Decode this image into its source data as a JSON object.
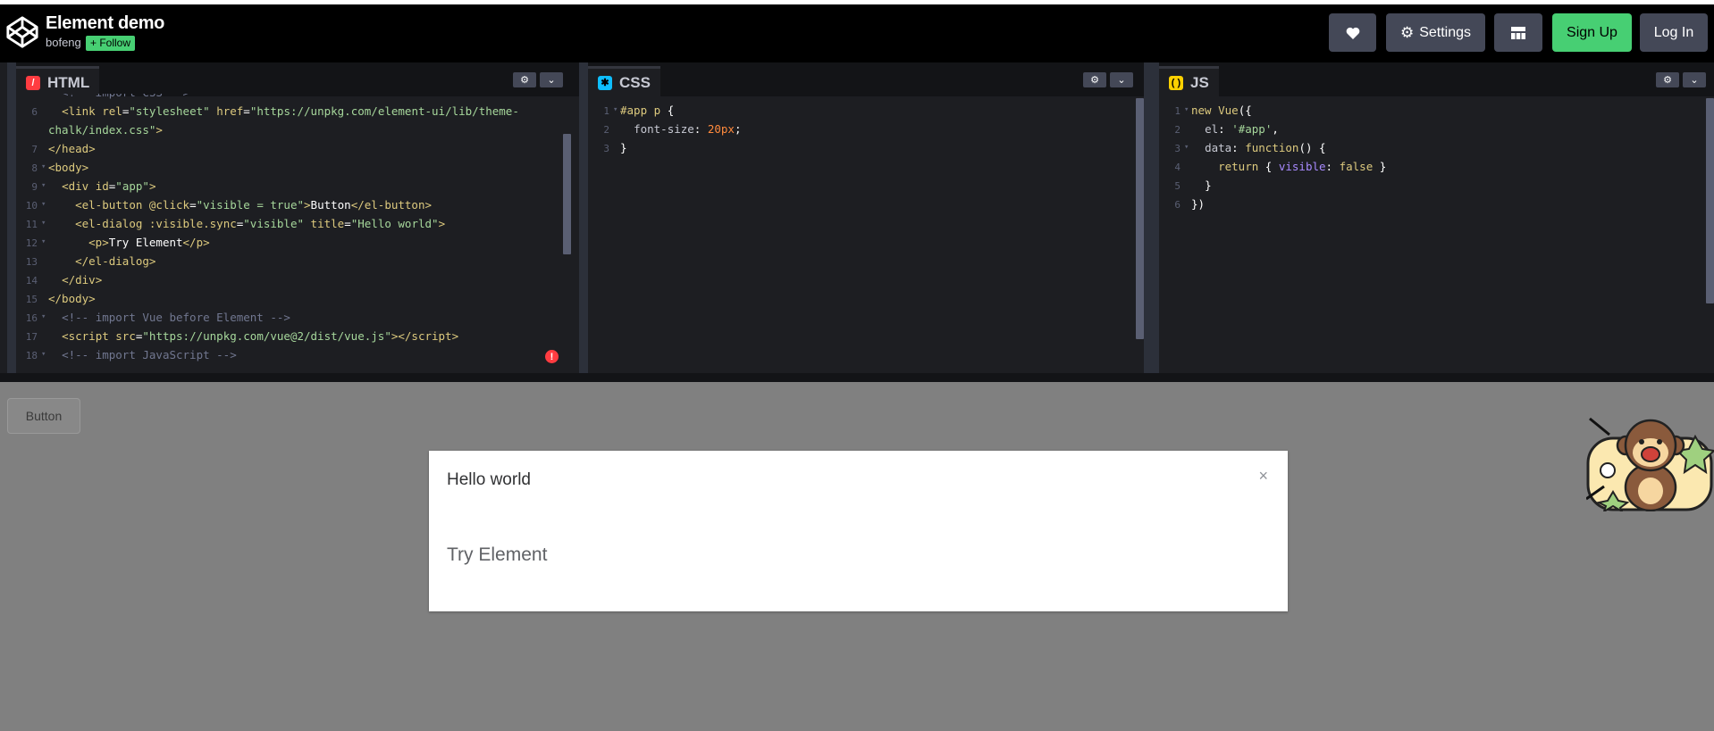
{
  "header": {
    "title": "Element demo",
    "author": "bofeng",
    "follow_label": "+ Follow",
    "settings_label": "Settings",
    "signup_label": "Sign Up",
    "login_label": "Log In"
  },
  "editors": {
    "html": {
      "label": "HTML"
    },
    "css": {
      "label": "CSS"
    },
    "js": {
      "label": "JS"
    }
  },
  "preview": {
    "button_label": "Button",
    "dialog_title": "Hello world",
    "dialog_body": "Try Element",
    "dialog_close": "×"
  }
}
